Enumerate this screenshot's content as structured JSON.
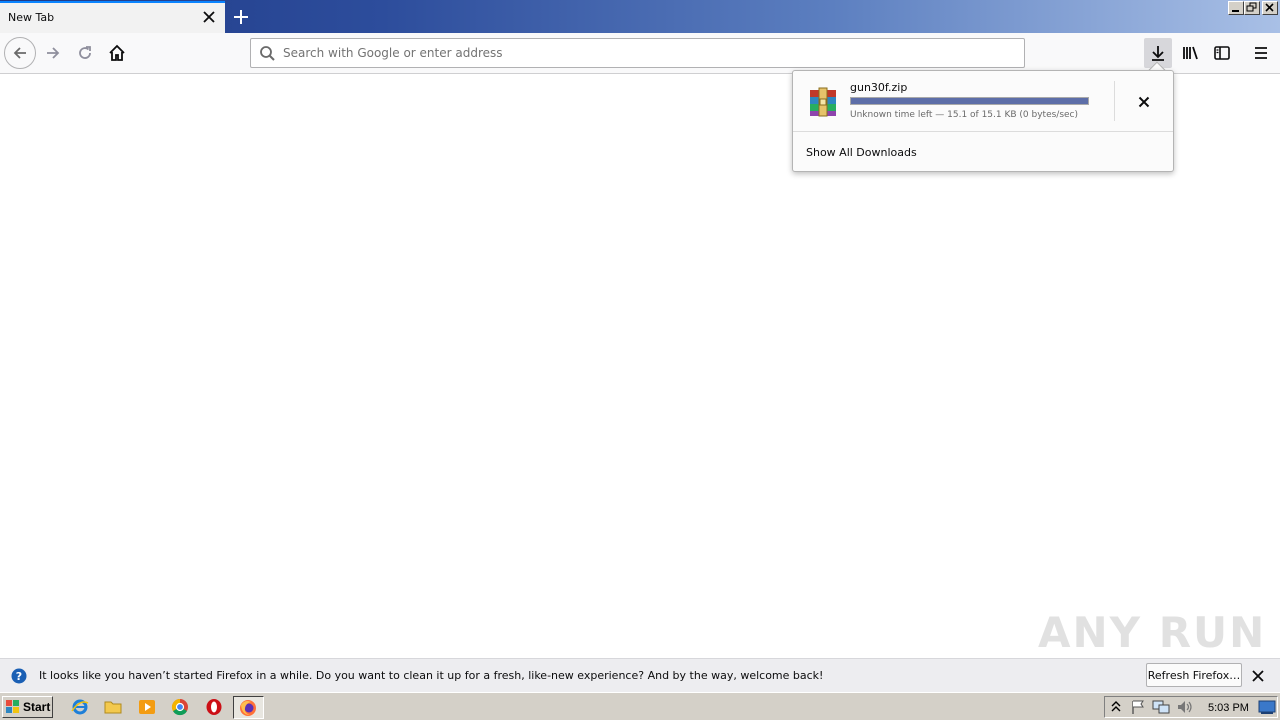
{
  "browser": {
    "tab_title": "New Tab",
    "url_placeholder": "Search with Google or enter address",
    "accent_color": "#0a84ff"
  },
  "downloads_panel": {
    "filename": "gun30f.zip",
    "status": "Unknown time left — 15.1 of 15.1 KB (0 bytes/sec)",
    "progress": 1.0,
    "show_all_label": "Show All Downloads",
    "file_icon": "winrar-archive-icon"
  },
  "notification": {
    "message": "It looks like you haven’t started Firefox in a while. Do you want to clean it up for a fresh, like-new experience? And by the way, welcome back!",
    "button_label": "Refresh Firefox…"
  },
  "watermark": "ANY RUN",
  "taskbar": {
    "start_label": "Start",
    "clock": "5:03 PM",
    "pinned": [
      "internet-explorer-icon",
      "folder-icon",
      "media-player-icon",
      "chrome-icon",
      "opera-icon",
      "firefox-icon"
    ]
  }
}
